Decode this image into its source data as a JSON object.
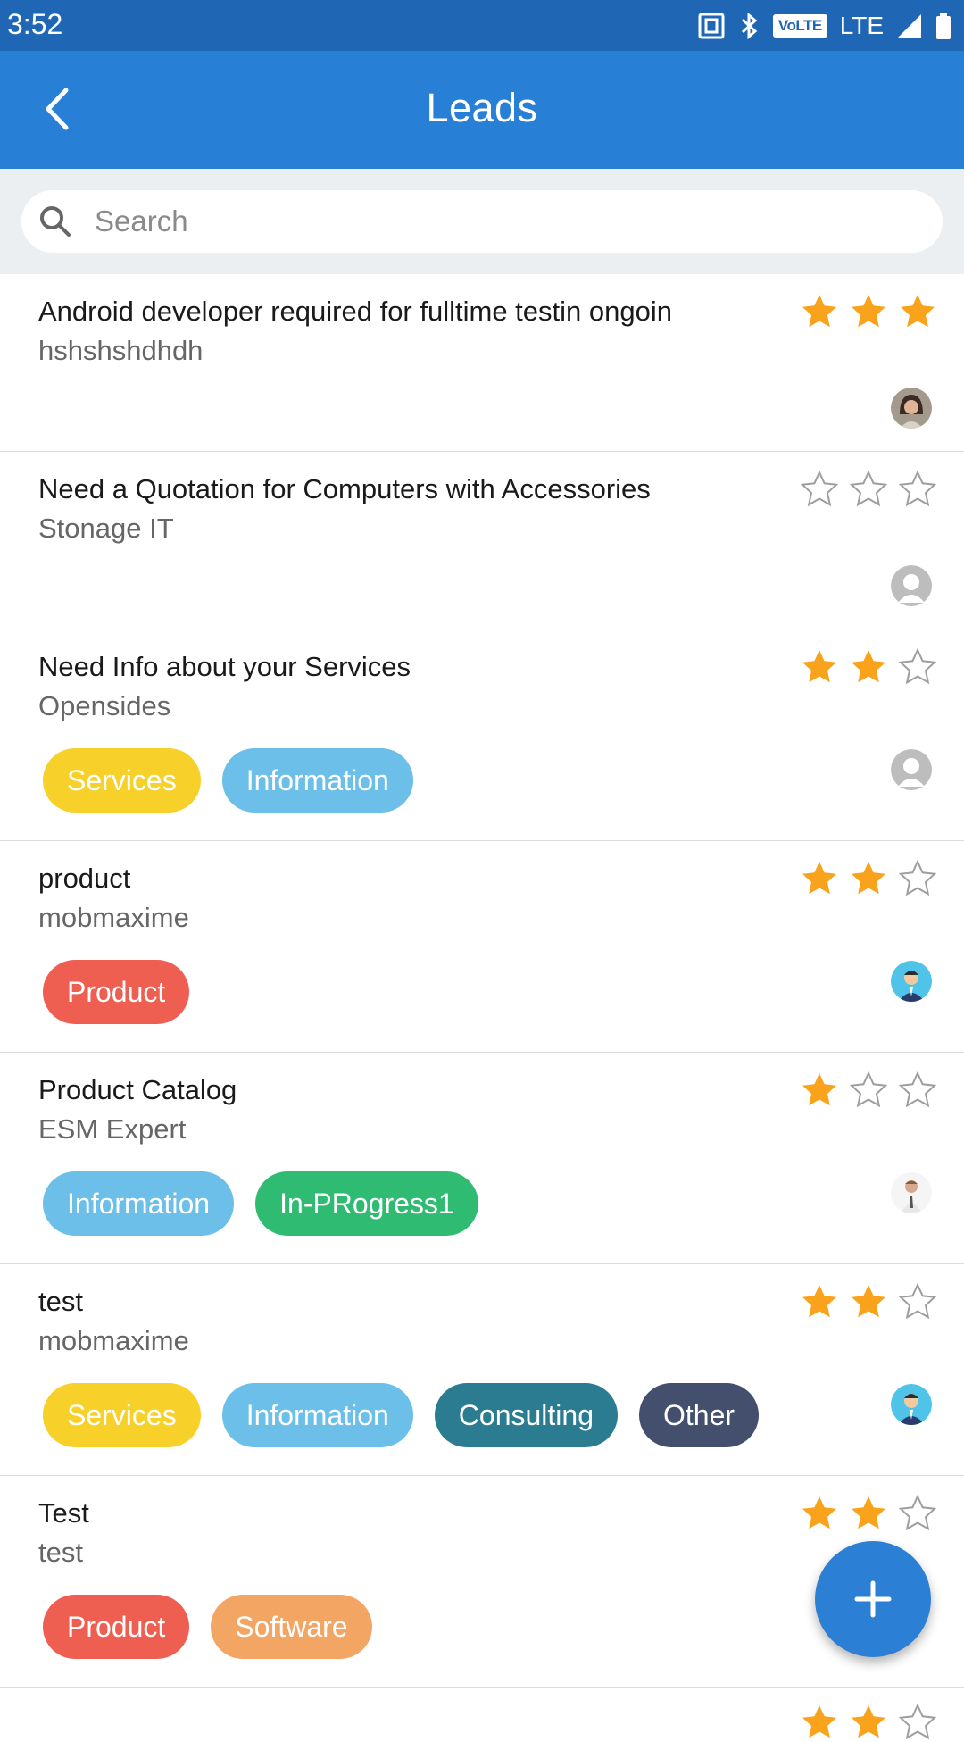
{
  "status_bar": {
    "time": "3:52",
    "volte": "VoLTE",
    "network": "LTE"
  },
  "header": {
    "title": "Leads"
  },
  "search": {
    "placeholder": "Search"
  },
  "colors": {
    "star_filled": "#f9a21b",
    "star_empty": "#9e9e9e",
    "tag_services": "#f7d02a",
    "tag_information": "#6cbfe9",
    "tag_product": "#ee5f52",
    "tag_in_progress": "#2fbc72",
    "tag_consulting": "#2b7c90",
    "tag_other": "#434f6d",
    "tag_software": "#f3a564"
  },
  "leads": [
    {
      "title": "Android developer required for fulltime testin ongoin",
      "subtitle": "hshshshdhdh",
      "rating": 3,
      "avatar": "female-photo",
      "tags": []
    },
    {
      "title": "Need a Quotation for Computers with Accessories",
      "subtitle": "Stonage IT",
      "rating": 0,
      "avatar": "placeholder",
      "tags": []
    },
    {
      "title": "Need Info about your Services",
      "subtitle": "Opensides",
      "rating": 2,
      "avatar": "placeholder",
      "tags": [
        {
          "label": "Services",
          "color": "#f7d02a"
        },
        {
          "label": "Information",
          "color": "#6cbfe9"
        }
      ]
    },
    {
      "title": "product",
      "subtitle": "mobmaxime",
      "rating": 2,
      "avatar": "businessman-cartoon",
      "tags": [
        {
          "label": "Product",
          "color": "#ee5f52"
        }
      ]
    },
    {
      "title": "Product Catalog",
      "subtitle": "ESM Expert",
      "rating": 1,
      "avatar": "male-photo",
      "tags": [
        {
          "label": "Information",
          "color": "#6cbfe9"
        },
        {
          "label": "In-PRogress1",
          "color": "#2fbc72"
        }
      ]
    },
    {
      "title": "test",
      "subtitle": "mobmaxime",
      "rating": 2,
      "avatar": "businessman-cartoon",
      "tags": [
        {
          "label": "Services",
          "color": "#f7d02a"
        },
        {
          "label": "Information",
          "color": "#6cbfe9"
        },
        {
          "label": "Consulting",
          "color": "#2b7c90"
        },
        {
          "label": "Other",
          "color": "#434f6d"
        }
      ]
    },
    {
      "title": "Test",
      "subtitle": "test",
      "rating": 2,
      "avatar": "none",
      "tags": [
        {
          "label": "Product",
          "color": "#ee5f52"
        },
        {
          "label": "Software",
          "color": "#f3a564"
        }
      ]
    }
  ],
  "fab": {
    "icon": "plus-icon"
  }
}
